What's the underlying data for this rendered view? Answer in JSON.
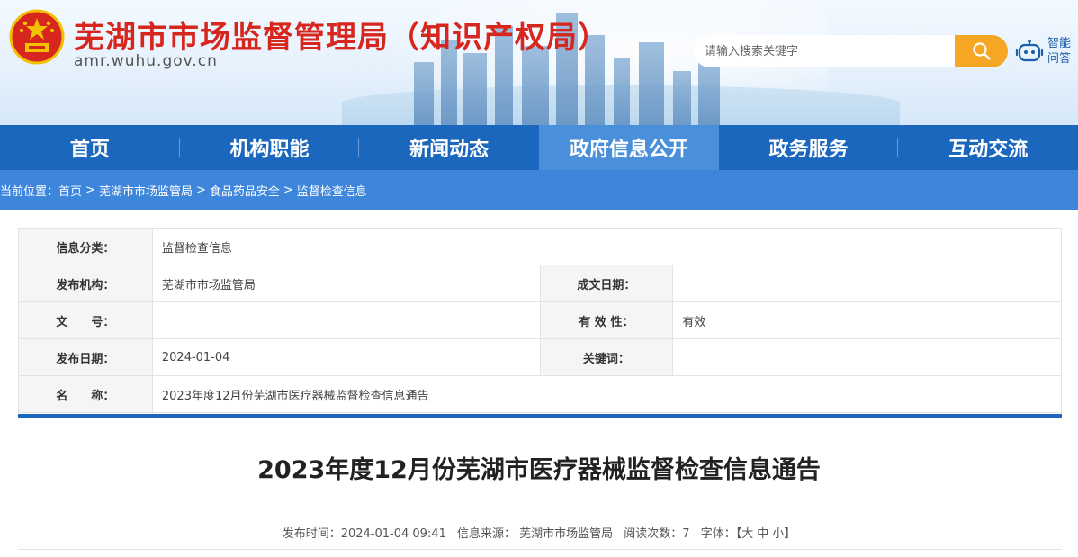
{
  "header": {
    "site_title": "芜湖市市场监督管理局（知识产权局）",
    "domain": "amr.wuhu.gov.cn",
    "search_placeholder": "请输入搜索关键字",
    "ai_label_line1": "智能",
    "ai_label_line2": "问答"
  },
  "nav": {
    "items": [
      {
        "label": "首页"
      },
      {
        "label": "机构职能"
      },
      {
        "label": "新闻动态"
      },
      {
        "label": "政府信息公开"
      },
      {
        "label": "政务服务"
      },
      {
        "label": "互动交流"
      }
    ],
    "active_index": 3
  },
  "breadcrumb": {
    "prefix": "当前位置：",
    "items": [
      "首页",
      "芜湖市市场监管局",
      "食品药品安全",
      "监督检查信息"
    ],
    "separator": ">"
  },
  "info": {
    "category_label": "信息分类：",
    "category_value": "监督检查信息",
    "publisher_label": "发布机构：",
    "publisher_value": "芜湖市市场监管局",
    "created_label": "成文日期：",
    "created_value": "",
    "doc_no_label": "文　　号：",
    "doc_no_value": "",
    "validity_label": "有 效 性：",
    "validity_value": "有效",
    "pub_date_label": "发布日期：",
    "pub_date_value": "2024-01-04",
    "keywords_label": "关键词：",
    "keywords_value": "",
    "name_label": "名　　称：",
    "name_value": "2023年度12月份芜湖市医疗器械监督检查信息通告"
  },
  "article": {
    "title": "2023年度12月份芜湖市医疗器械监督检查信息通告",
    "pub_time": "发布时间：2024-01-04 09:41",
    "source": "信息来源：  芜湖市市场监管局",
    "views": "阅读次数：7",
    "font_label": "字体：【",
    "font_large": "大",
    "font_medium": "中",
    "font_small": "小",
    "font_close": "】"
  },
  "colors": {
    "nav_bg": "#1a67bd",
    "nav_active": "#4a8fd9",
    "title_red": "#d7261e",
    "search_btn": "#f5a623"
  }
}
